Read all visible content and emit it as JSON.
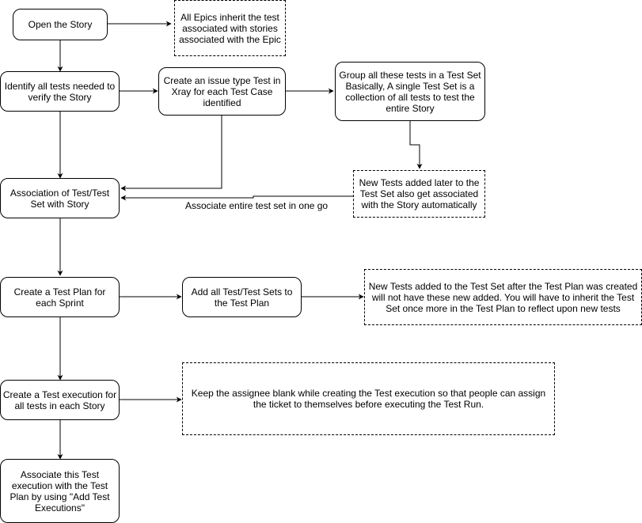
{
  "diagram": {
    "nodes": {
      "open_story": "Open the Story",
      "epics_note": "All Epics inherit the test associated with stories associated with the Epic",
      "identify_tests": "Identify all tests needed to verify the Story",
      "create_issue": "Create an issue type Test in Xray for each Test Case identified",
      "group_tests": "Group all these tests in a Test Set Basically, A single Test Set is a collection of all tests to test the entire Story",
      "new_tests_note": "New Tests added later to the Test Set also get associated with the Story automatically",
      "association": "Association of Test/Test Set with Story",
      "create_plan": "Create a Test Plan for each Sprint",
      "add_sets": "Add all Test/Test Sets to the Test Plan",
      "plan_note": "New Tests added to the Test Set after the Test Plan was created will not have these new added. You will have to inherit the Test Set once more in the Test Plan to reflect upon new tests",
      "create_execution": "Create a Test execution for all tests in each Story",
      "assignee_note": "Keep the assignee blank while creating the Test execution so that people can assign the ticket to themselves before executing the Test Run.",
      "associate_execution": "Associate this Test execution with the Test Plan by using \"Add Test Executions\""
    },
    "edge_labels": {
      "associate_entire": "Associate entire test set in one go"
    },
    "colors": {
      "stroke": "#000000",
      "grey_stroke": "#808080"
    }
  }
}
